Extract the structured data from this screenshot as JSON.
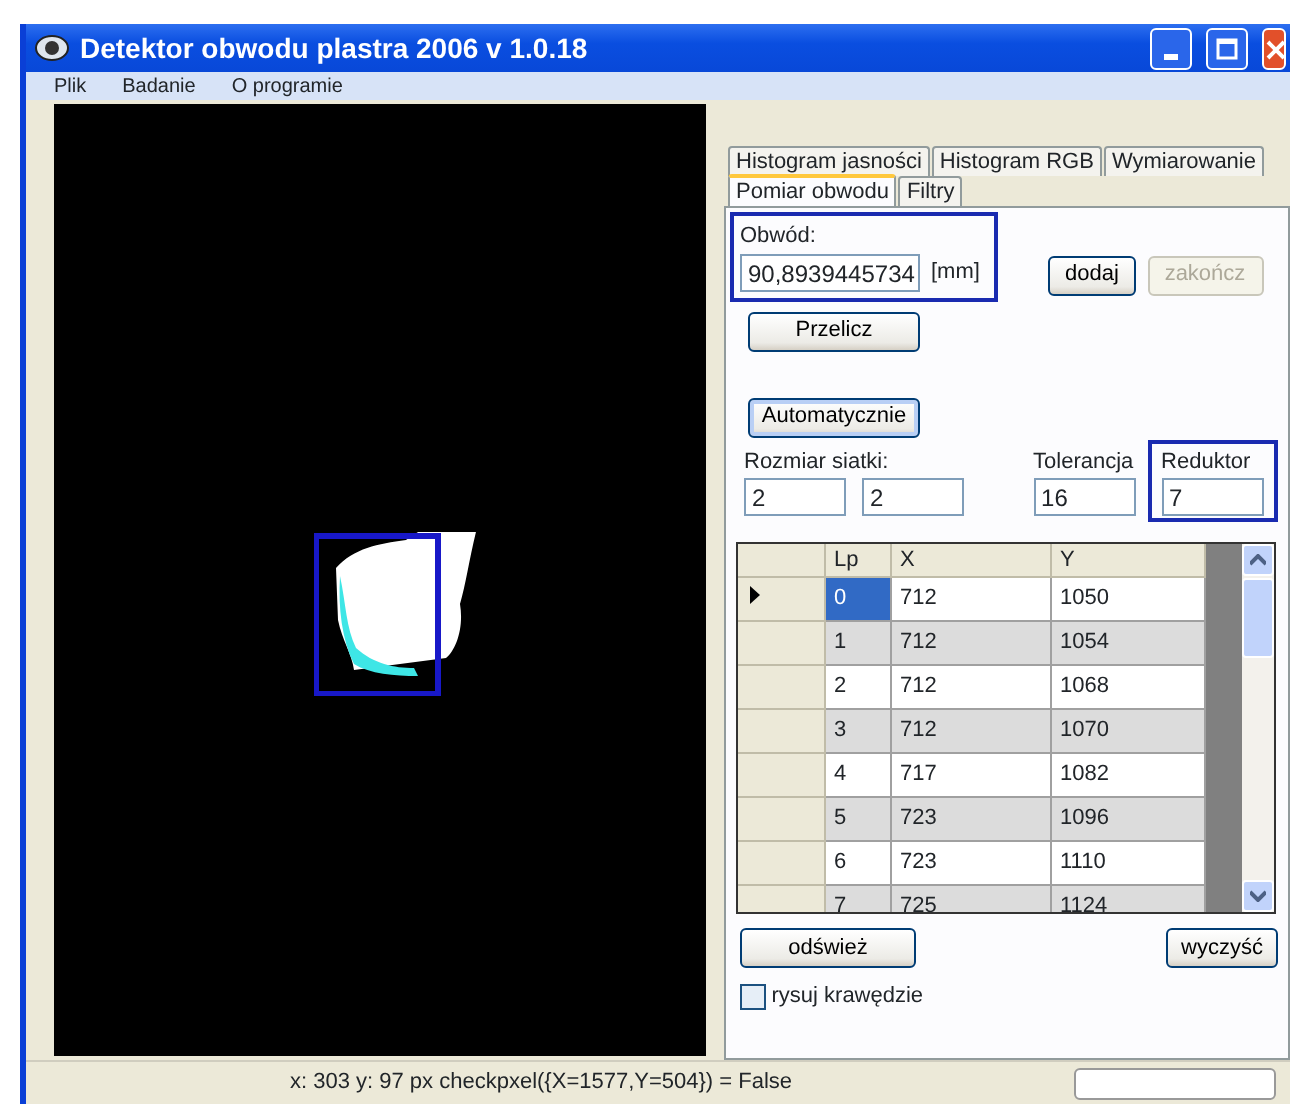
{
  "window": {
    "title": "Detektor obwodu plastra 2006 v 1.0.18"
  },
  "menu": [
    "Plik",
    "Badanie",
    "O programie"
  ],
  "tabs_row_1": [
    {
      "label": "Histogram jasności",
      "selected": false
    },
    {
      "label": "Histogram RGB",
      "selected": false
    },
    {
      "label": "Wymiarowanie",
      "selected": false
    }
  ],
  "tabs_row_2": [
    {
      "label": "Pomiar obwodu",
      "selected": true
    },
    {
      "label": "Filtry",
      "selected": false
    }
  ],
  "perimeter": {
    "label": "Obwód:",
    "value": "90,8939445734",
    "unit": "[mm]",
    "highlighted": true
  },
  "buttons": [
    {
      "label": "dodaj",
      "disabled": false
    },
    {
      "label": "zakończ",
      "disabled": true
    }
  ],
  "recalc_button": {
    "label": "Przelicz"
  },
  "auto_button": {
    "label": "Automatycznie",
    "focused": true
  },
  "grid_size": {
    "label": "Rozmiar siatki:",
    "values": [
      "2",
      "2"
    ]
  },
  "tolerance": {
    "label": "Tolerancja",
    "value": "16",
    "highlighted": false
  },
  "reducer": {
    "label": "Reduktor",
    "value": "7",
    "highlighted": true
  },
  "table": {
    "columns": [
      "Lp",
      "X",
      "Y"
    ],
    "rows": [
      {
        "cells": [
          "0",
          "712",
          "1050"
        ],
        "current": true,
        "selected": true
      },
      {
        "cells": [
          "1",
          "712",
          "1054"
        ],
        "current": false,
        "selected": false
      },
      {
        "cells": [
          "2",
          "712",
          "1068"
        ],
        "current": false,
        "selected": false
      },
      {
        "cells": [
          "3",
          "712",
          "1070"
        ],
        "current": false,
        "selected": false
      },
      {
        "cells": [
          "4",
          "717",
          "1082"
        ],
        "current": false,
        "selected": false
      },
      {
        "cells": [
          "5",
          "723",
          "1096"
        ],
        "current": false,
        "selected": false
      },
      {
        "cells": [
          "6",
          "723",
          "1110"
        ],
        "current": false,
        "selected": false
      },
      {
        "cells": [
          "7",
          "725",
          "1124"
        ],
        "current": false,
        "selected": false
      }
    ]
  },
  "refresh_button": "odśwież",
  "clear_button": "wyczyść",
  "draw_edges": {
    "label": "rysuj krawędzie",
    "checked": false
  },
  "status_bar": {
    "text": "x: 303 y: 97 px checkpxel({X=1577,Y=504}) = False"
  }
}
